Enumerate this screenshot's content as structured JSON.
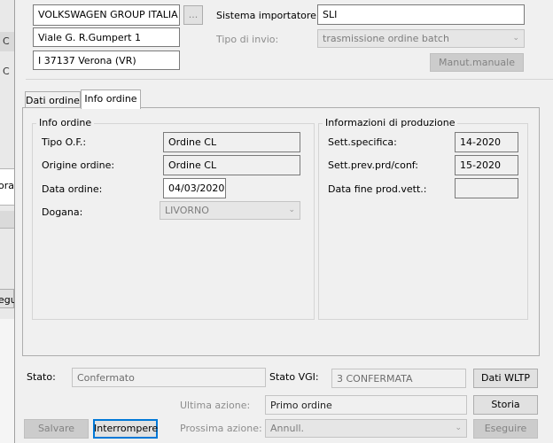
{
  "background": {
    "text_a": "C",
    "text_b": "C",
    "text_c": "orat",
    "text_d": "egu"
  },
  "header": {
    "importer_name": "VOLKSWAGEN GROUP ITALIA S.",
    "browse_label": "...",
    "address": "Viale G. R.Gumpert 1",
    "city": "I 37137 Verona (VR)",
    "sistema_label": "Sistema importatore:",
    "sistema_value": "SLI",
    "tipo_invio_label": "Tipo di invio:",
    "tipo_invio_value": "trasmissione ordine batch",
    "manual_button": "Manut.manuale"
  },
  "tabs": [
    {
      "label": "Dati ordine"
    },
    {
      "label": "Info ordine"
    }
  ],
  "info_ordine": {
    "title": "Info ordine",
    "tipo_of_label": "Tipo O.F.:",
    "tipo_of_value": "Ordine CL",
    "origine_label": "Origine ordine:",
    "origine_value": "Ordine CL",
    "data_label": "Data ordine:",
    "data_value": "04/03/2020",
    "dogana_label": "Dogana:",
    "dogana_value": "LIVORNO"
  },
  "produzione": {
    "title": "Informazioni di produzione",
    "sett_spec_label": "Sett.specifica:",
    "sett_spec_value": "14-2020",
    "sett_prev_label": "Sett.prev.prd/conf:",
    "sett_prev_value": "15-2020",
    "data_fine_label": "Data fine prod.vett.:",
    "data_fine_value": ""
  },
  "footer": {
    "stato_label": "Stato:",
    "stato_value": "Confermato",
    "stato_vgi_label": "Stato VGI:",
    "stato_vgi_value": "3 CONFERMATA",
    "dati_wltp": "Dati WLTP",
    "ultima_label": "Ultima azione:",
    "ultima_value": "Primo ordine",
    "storia": "Storia",
    "salvare": "Salvare",
    "interrompere": "Interrompere",
    "prossima_label": "Prossima azione:",
    "prossima_value": "Annull.",
    "eseguire": "Eseguire"
  }
}
